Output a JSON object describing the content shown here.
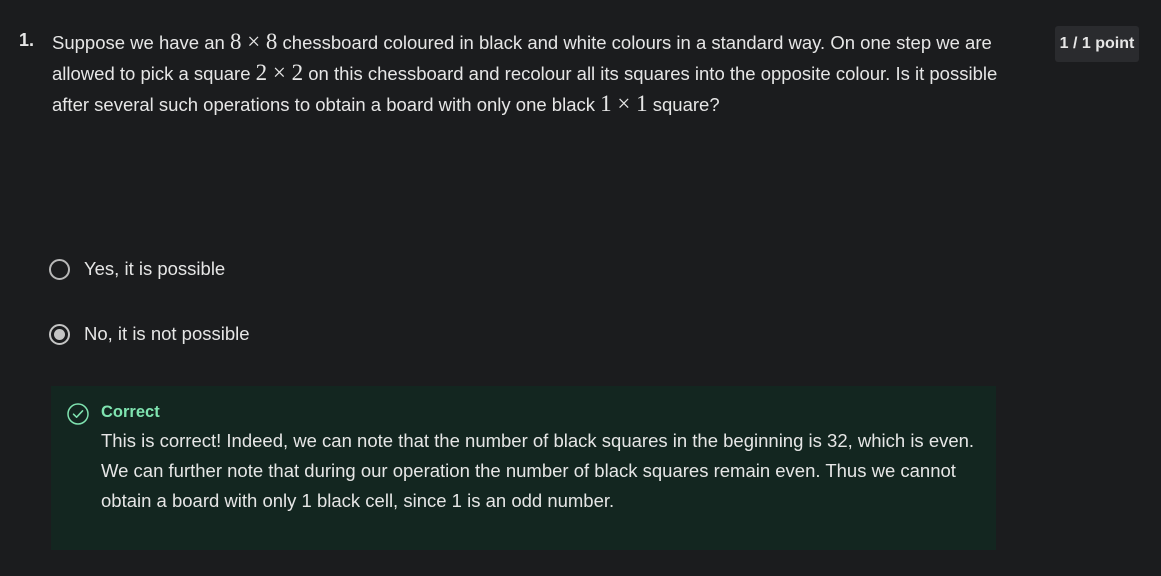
{
  "question": {
    "number": "1.",
    "text_1": "Suppose we have an ",
    "math_1": "8 × 8",
    "text_2": " chessboard coloured in black and white colours in a standard way. On one step we are allowed to pick a square ",
    "math_2": "2 × 2",
    "text_3": " on this chessboard and recolour all its squares into the opposite colour. Is it possible after several such operations to obtain a board with only one black ",
    "math_3": "1 × 1",
    "text_4": " square?"
  },
  "points": "1 / 1 point",
  "options": [
    {
      "label": "Yes, it is possible",
      "selected": false
    },
    {
      "label": "No, it is not possible",
      "selected": true
    }
  ],
  "feedback": {
    "status": "Correct",
    "icon": "check-circle-icon",
    "text": "This is correct! Indeed, we can note that the number of black squares in the beginning is 32, which is even. We can further note that during our operation the number of black squares remain even. Thus we cannot obtain a board with only 1 black cell, since 1 is an odd number."
  },
  "colors": {
    "background": "#1b1c1e",
    "feedback_bg": "#132620",
    "correct_green": "#7fe3b0"
  }
}
